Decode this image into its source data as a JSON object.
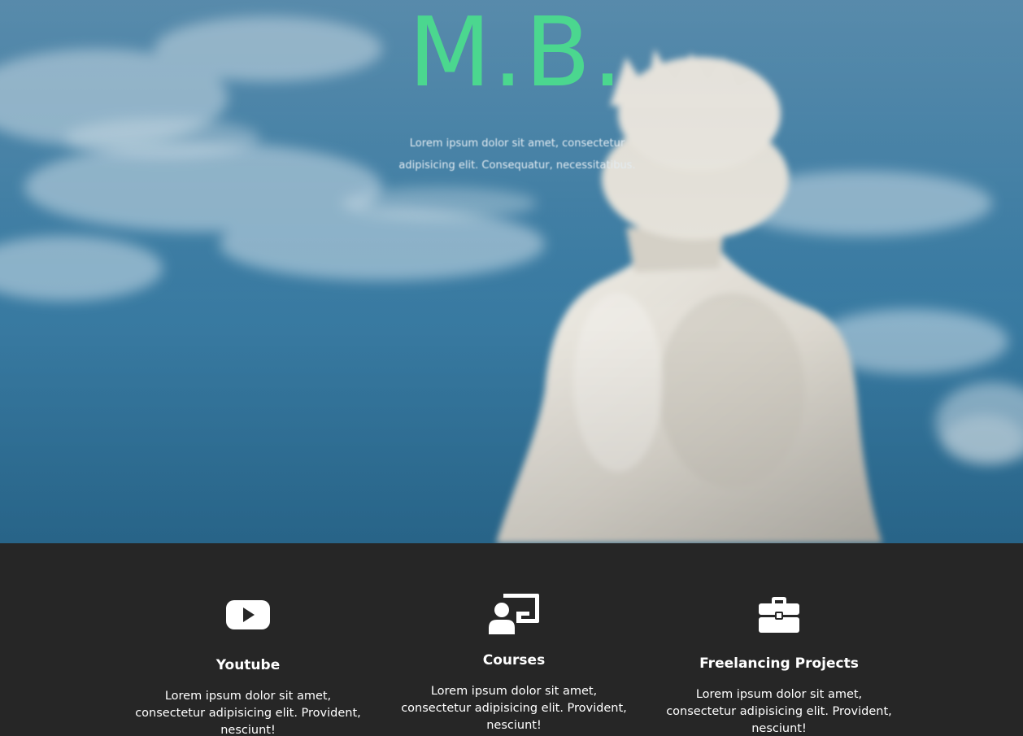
{
  "hero": {
    "logo": "M.B.",
    "tagline": "Lorem ipsum dolor sit amet, consectetur adipisicing elit. Consequatur, necessitatibus.",
    "colors": {
      "logo": "#4bd78f",
      "sky": "#3a7aa0"
    }
  },
  "features": [
    {
      "icon": "youtube-icon",
      "title": "Youtube",
      "description": "Lorem ipsum dolor sit amet, consectetur adipisicing elit. Provident, nesciunt!"
    },
    {
      "icon": "chalkboard-teacher-icon",
      "title": "Courses",
      "description": "Lorem ipsum dolor sit amet, consectetur adipisicing elit. Provident, nesciunt!"
    },
    {
      "icon": "briefcase-icon",
      "title": "Freelancing Projects",
      "description": "Lorem ipsum dolor sit amet, consectetur adipisicing elit. Provident, nesciunt!"
    }
  ],
  "colors": {
    "section_bg": "#262626",
    "text": "#ffffff"
  }
}
